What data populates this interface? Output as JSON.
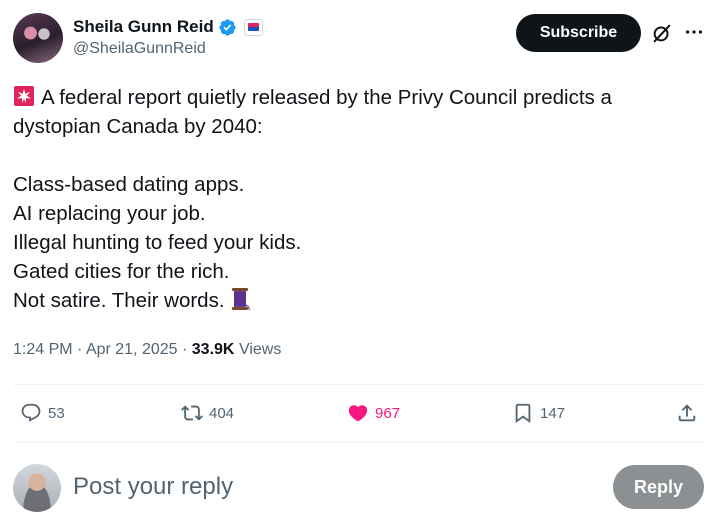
{
  "author": {
    "display_name": "Sheila Gunn Reid",
    "handle": "@SheilaGunnReid",
    "verified": true,
    "affiliate_badge": "news-outlet-badge"
  },
  "header": {
    "subscribe_label": "Subscribe",
    "grok_icon": "grok-icon",
    "more_icon": "more-icon"
  },
  "tweet": {
    "line1": "A federal report quietly released by the Privy Council predicts a",
    "line2": "dystopian Canada by 2040:",
    "line3": "Class-based dating apps.",
    "line4": "AI replacing your job.",
    "line5": "Illegal hunting to feed your kids.",
    "line6": "Gated cities for the rich.",
    "line7": "Not satire. Their words.",
    "leading_emoji": "police-light-emoji",
    "trailing_emoji": "thread-emoji"
  },
  "meta": {
    "time": "1:24 PM",
    "separator": " · ",
    "date": "Apr 21, 2025",
    "views_count": "33.9K",
    "views_label": "Views"
  },
  "actions": {
    "replies": "53",
    "reposts": "404",
    "likes": "967",
    "bookmarks": "147",
    "liked": true,
    "like_color": "#f91880"
  },
  "reply": {
    "placeholder": "Post your reply",
    "button_label": "Reply"
  }
}
